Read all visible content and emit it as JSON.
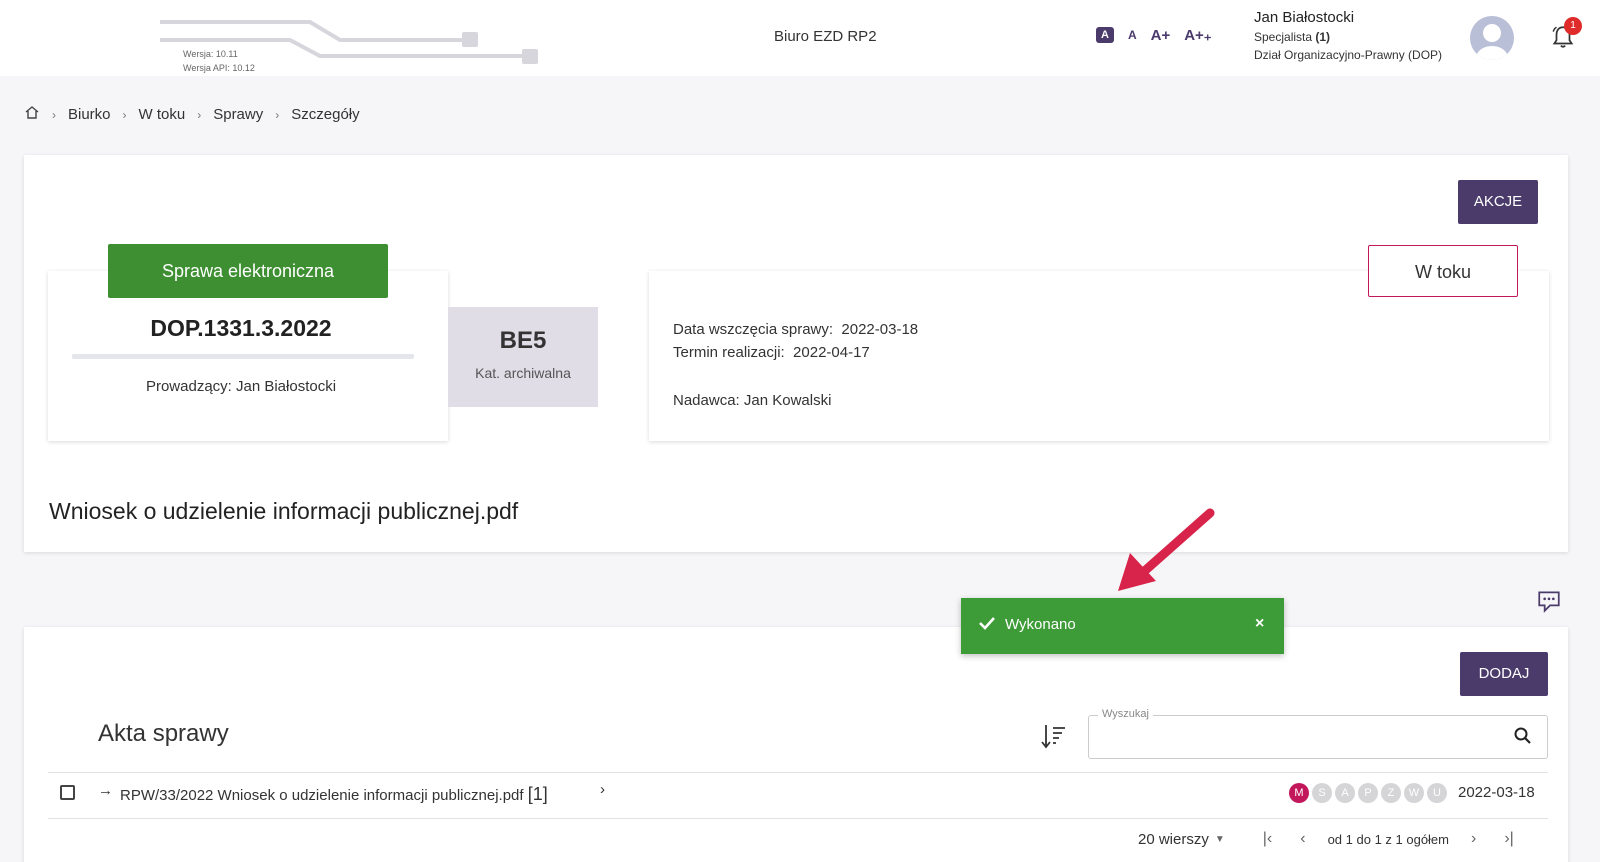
{
  "header": {
    "app_title": "Biuro EZD RP2",
    "version": "Wersja: 10.11",
    "api_version": "Wersja API: 10.12",
    "font_sizes": [
      "A",
      "A",
      "A+",
      "A+₊"
    ],
    "user": {
      "name": "Jan Białostocki",
      "role": "Specjalista",
      "role_count": "(1)",
      "department": "Dział Organizacyjno-Prawny (DOP)"
    },
    "notification_count": "1"
  },
  "breadcrumb": [
    "Biurko",
    "W toku",
    "Sprawy",
    "Szczegóły"
  ],
  "case": {
    "actions_label": "AKCJE",
    "type_label": "Sprawa elektroniczna",
    "number": "DOP.1331.3.2022",
    "lead": "Prowadzący: Jan Białostocki",
    "archive_code": "BE5",
    "archive_label": "Kat. archiwalna",
    "status": "W toku",
    "start_label": "Data wszczęcia sprawy:",
    "start_date": "2022-03-18",
    "deadline_label": "Termin realizacji:",
    "deadline_date": "2022-04-17",
    "sender": "Nadawca: Jan Kowalski",
    "title": "Wniosek o udzielenie informacji publicznej.pdf"
  },
  "toast": {
    "message": "Wykonano"
  },
  "akta": {
    "add_label": "DODAJ",
    "title": "Akta sprawy",
    "search_label": "Wyszukaj",
    "rows": [
      {
        "text": "RPW/33/2022 Wniosek o udzielenie informacji publicznej.pdf",
        "count": "[1]",
        "days": [
          "M",
          "S",
          "A",
          "P",
          "Z",
          "W",
          "U"
        ],
        "date": "2022-03-18"
      }
    ],
    "pager": {
      "rows_per_page": "20 wierszy",
      "range": "od 1 do 1 z 1 ogółem"
    }
  },
  "colors": {
    "primary": "#4a3b6b",
    "success": "#3d8f31",
    "accent": "#c2185b"
  }
}
